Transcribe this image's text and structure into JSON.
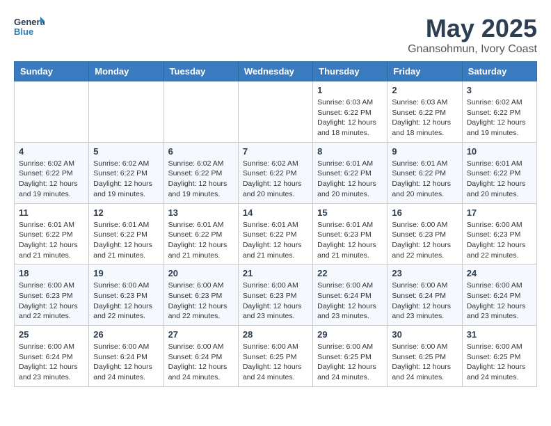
{
  "header": {
    "logo_line1": "General",
    "logo_line2": "Blue",
    "main_title": "May 2025",
    "subtitle": "Gnansohmun, Ivory Coast"
  },
  "weekdays": [
    "Sunday",
    "Monday",
    "Tuesday",
    "Wednesday",
    "Thursday",
    "Friday",
    "Saturday"
  ],
  "weeks": [
    [
      {
        "day": "",
        "info": ""
      },
      {
        "day": "",
        "info": ""
      },
      {
        "day": "",
        "info": ""
      },
      {
        "day": "",
        "info": ""
      },
      {
        "day": "1",
        "info": "Sunrise: 6:03 AM\nSunset: 6:22 PM\nDaylight: 12 hours\nand 18 minutes."
      },
      {
        "day": "2",
        "info": "Sunrise: 6:03 AM\nSunset: 6:22 PM\nDaylight: 12 hours\nand 18 minutes."
      },
      {
        "day": "3",
        "info": "Sunrise: 6:02 AM\nSunset: 6:22 PM\nDaylight: 12 hours\nand 19 minutes."
      }
    ],
    [
      {
        "day": "4",
        "info": "Sunrise: 6:02 AM\nSunset: 6:22 PM\nDaylight: 12 hours\nand 19 minutes."
      },
      {
        "day": "5",
        "info": "Sunrise: 6:02 AM\nSunset: 6:22 PM\nDaylight: 12 hours\nand 19 minutes."
      },
      {
        "day": "6",
        "info": "Sunrise: 6:02 AM\nSunset: 6:22 PM\nDaylight: 12 hours\nand 19 minutes."
      },
      {
        "day": "7",
        "info": "Sunrise: 6:02 AM\nSunset: 6:22 PM\nDaylight: 12 hours\nand 20 minutes."
      },
      {
        "day": "8",
        "info": "Sunrise: 6:01 AM\nSunset: 6:22 PM\nDaylight: 12 hours\nand 20 minutes."
      },
      {
        "day": "9",
        "info": "Sunrise: 6:01 AM\nSunset: 6:22 PM\nDaylight: 12 hours\nand 20 minutes."
      },
      {
        "day": "10",
        "info": "Sunrise: 6:01 AM\nSunset: 6:22 PM\nDaylight: 12 hours\nand 20 minutes."
      }
    ],
    [
      {
        "day": "11",
        "info": "Sunrise: 6:01 AM\nSunset: 6:22 PM\nDaylight: 12 hours\nand 21 minutes."
      },
      {
        "day": "12",
        "info": "Sunrise: 6:01 AM\nSunset: 6:22 PM\nDaylight: 12 hours\nand 21 minutes."
      },
      {
        "day": "13",
        "info": "Sunrise: 6:01 AM\nSunset: 6:22 PM\nDaylight: 12 hours\nand 21 minutes."
      },
      {
        "day": "14",
        "info": "Sunrise: 6:01 AM\nSunset: 6:22 PM\nDaylight: 12 hours\nand 21 minutes."
      },
      {
        "day": "15",
        "info": "Sunrise: 6:01 AM\nSunset: 6:23 PM\nDaylight: 12 hours\nand 21 minutes."
      },
      {
        "day": "16",
        "info": "Sunrise: 6:00 AM\nSunset: 6:23 PM\nDaylight: 12 hours\nand 22 minutes."
      },
      {
        "day": "17",
        "info": "Sunrise: 6:00 AM\nSunset: 6:23 PM\nDaylight: 12 hours\nand 22 minutes."
      }
    ],
    [
      {
        "day": "18",
        "info": "Sunrise: 6:00 AM\nSunset: 6:23 PM\nDaylight: 12 hours\nand 22 minutes."
      },
      {
        "day": "19",
        "info": "Sunrise: 6:00 AM\nSunset: 6:23 PM\nDaylight: 12 hours\nand 22 minutes."
      },
      {
        "day": "20",
        "info": "Sunrise: 6:00 AM\nSunset: 6:23 PM\nDaylight: 12 hours\nand 22 minutes."
      },
      {
        "day": "21",
        "info": "Sunrise: 6:00 AM\nSunset: 6:23 PM\nDaylight: 12 hours\nand 23 minutes."
      },
      {
        "day": "22",
        "info": "Sunrise: 6:00 AM\nSunset: 6:24 PM\nDaylight: 12 hours\nand 23 minutes."
      },
      {
        "day": "23",
        "info": "Sunrise: 6:00 AM\nSunset: 6:24 PM\nDaylight: 12 hours\nand 23 minutes."
      },
      {
        "day": "24",
        "info": "Sunrise: 6:00 AM\nSunset: 6:24 PM\nDaylight: 12 hours\nand 23 minutes."
      }
    ],
    [
      {
        "day": "25",
        "info": "Sunrise: 6:00 AM\nSunset: 6:24 PM\nDaylight: 12 hours\nand 23 minutes."
      },
      {
        "day": "26",
        "info": "Sunrise: 6:00 AM\nSunset: 6:24 PM\nDaylight: 12 hours\nand 24 minutes."
      },
      {
        "day": "27",
        "info": "Sunrise: 6:00 AM\nSunset: 6:24 PM\nDaylight: 12 hours\nand 24 minutes."
      },
      {
        "day": "28",
        "info": "Sunrise: 6:00 AM\nSunset: 6:25 PM\nDaylight: 12 hours\nand 24 minutes."
      },
      {
        "day": "29",
        "info": "Sunrise: 6:00 AM\nSunset: 6:25 PM\nDaylight: 12 hours\nand 24 minutes."
      },
      {
        "day": "30",
        "info": "Sunrise: 6:00 AM\nSunset: 6:25 PM\nDaylight: 12 hours\nand 24 minutes."
      },
      {
        "day": "31",
        "info": "Sunrise: 6:00 AM\nSunset: 6:25 PM\nDaylight: 12 hours\nand 24 minutes."
      }
    ]
  ]
}
